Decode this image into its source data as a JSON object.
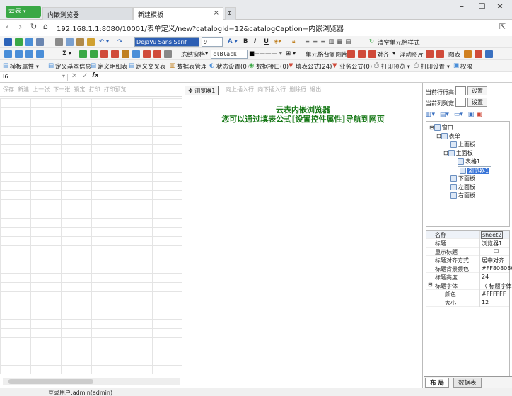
{
  "browser": {
    "brand": "云表",
    "tabs": [
      {
        "label": "内嵌浏览器",
        "active": false
      },
      {
        "label": "新建模板",
        "active": true
      }
    ],
    "address": "192.168.1.1:8080/10001/表单定义/new?catalogId=12&catalogCaption=内嵌浏览器"
  },
  "toolbar1": {
    "font_name": "DejaVu Sans Serif",
    "font_size": "9",
    "clear_format": "清空单元格样式"
  },
  "toolbar2": {
    "freeze": "冻结窗格",
    "color_name": "clBlack",
    "bg_image": "单元格背景图片",
    "align": "对齐",
    "float_image": "浮动图片",
    "chart": "图表"
  },
  "toolbar3": {
    "items": [
      "模板属性",
      "定义基本信息",
      "定义明细表",
      "定义交叉表",
      "数据表管理",
      "状态设置(0)",
      "数据接口(0)",
      "填表公式(24)",
      "业务公式(0)",
      "打印预览",
      "打印设置",
      "权限"
    ]
  },
  "formula_bar": {
    "cell_ref": "I6"
  },
  "left_actions": [
    "保存",
    "新建",
    "上一张",
    "下一张",
    "锁定",
    "打印",
    "打印预览"
  ],
  "center_actions": [
    "向上插入行",
    "向下插入行",
    "删除行",
    "退出"
  ],
  "browser_control": {
    "tag": "浏览器1",
    "title": "云表内嵌浏览器",
    "hint": "您可以通过填表公式[设置控件属性]导航到网页"
  },
  "right_panel": {
    "row_height_label": "当前行行高:",
    "col_width_label": "当前列列宽:",
    "set_button": "设置",
    "tree": [
      {
        "label": "窗口",
        "level": 0
      },
      {
        "label": "表单",
        "level": 1
      },
      {
        "label": "上面板",
        "level": 2
      },
      {
        "label": "主面板",
        "level": 2
      },
      {
        "label": "表格1",
        "level": 3
      },
      {
        "label": "浏览器1",
        "level": 3,
        "selected": true
      },
      {
        "label": "下面板",
        "level": 2
      },
      {
        "label": "左面板",
        "level": 2
      },
      {
        "label": "右面板",
        "level": 2
      }
    ],
    "props": [
      {
        "k": "名称",
        "v": "sheet2"
      },
      {
        "k": "标题",
        "v": "浏览器1"
      },
      {
        "k": "显示标题",
        "v": "☐"
      },
      {
        "k": "标题对齐方式",
        "v": "居中对齐"
      },
      {
        "k": "标题背景颜色",
        "v": "#FF808080"
      },
      {
        "k": "标题高度",
        "v": "24"
      },
      {
        "k": "标题字体",
        "v": "〈 标题字体"
      },
      {
        "k": "颜色",
        "v": "#FFFFFF"
      },
      {
        "k": "大小",
        "v": "12"
      }
    ],
    "bottom_tabs": [
      "布 局",
      "数据表"
    ]
  },
  "status": {
    "login": "登录用户:admin(admin)"
  },
  "colors": {
    "accent": "#3aa845",
    "hint_green": "#1a7a1a",
    "selection": "#3874d8"
  }
}
